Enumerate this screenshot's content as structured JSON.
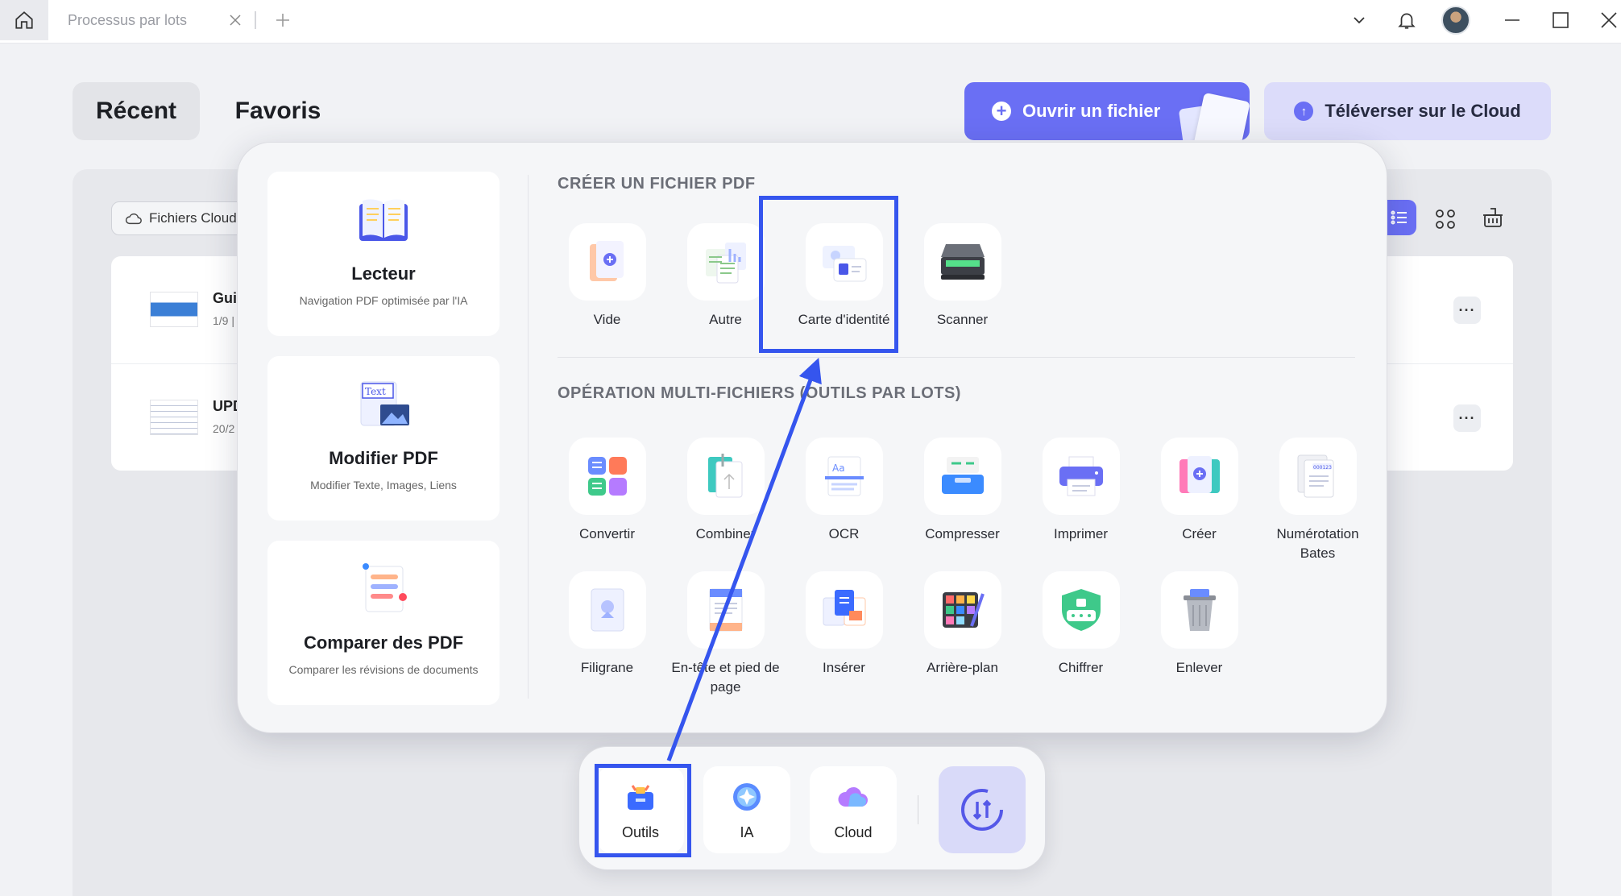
{
  "titlebar": {
    "tab_label": "Processus par lots"
  },
  "header": {
    "recent_label": "Récent",
    "favorites_label": "Favoris",
    "open_file_label": "Ouvrir un fichier",
    "upload_cloud_label": "Téléverser sur le Cloud"
  },
  "filelist": {
    "cloud_filter_label": "Fichiers Cloud",
    "rows": [
      {
        "name": "Gui",
        "meta": "1/9 |"
      },
      {
        "name": "UPD",
        "meta": "20/2"
      }
    ],
    "more_label": "···"
  },
  "popup": {
    "features": [
      {
        "title": "Lecteur",
        "desc": "Navigation PDF optimisée par l'IA"
      },
      {
        "title": "Modifier PDF",
        "desc": "Modifier Texte, Images, Liens"
      },
      {
        "title": "Comparer des PDF",
        "desc": "Comparer les révisions de documents"
      }
    ],
    "create_section_title": "CRÉER UN FICHIER PDF",
    "create_tools": [
      "Vide",
      "Autre",
      "Carte d'identité",
      "Scanner"
    ],
    "batch_section_title": "OPÉRATION MULTI-FICHIERS (OUTILS PAR LOTS)",
    "batch_tools_row1": [
      "Convertir",
      "Combiner",
      "OCR",
      "Compresser",
      "Imprimer",
      "Créer",
      "Numérotation Bates"
    ],
    "batch_tools_row2": [
      "Filigrane",
      "En-tête et pied de page",
      "Insérer",
      "Arrière-plan",
      "Chiffrer",
      "Enlever"
    ],
    "feature_icon_text": "Text"
  },
  "dock": {
    "items": [
      "Outils",
      "IA",
      "Cloud"
    ]
  },
  "colors": {
    "accent": "#6a6ff4",
    "highlight": "#3555ee"
  }
}
